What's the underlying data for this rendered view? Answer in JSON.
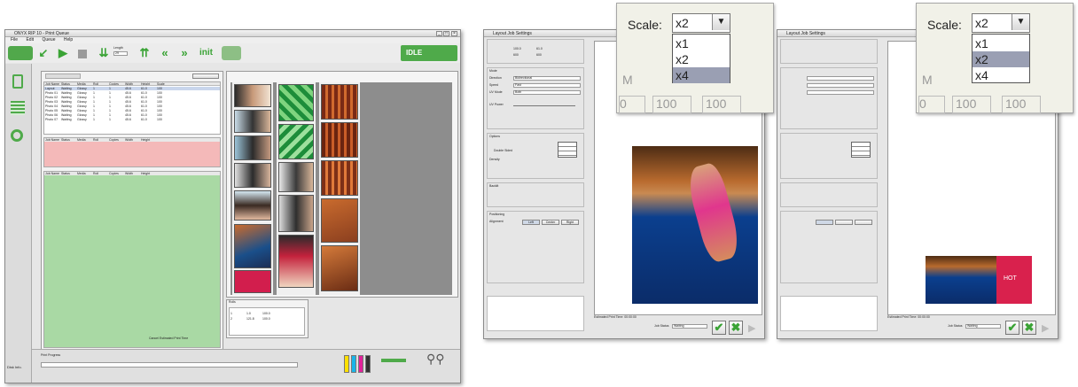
{
  "main": {
    "title": "ONYX RIP 10 - Print Queue",
    "menu": [
      "File",
      "Edit",
      "Queue",
      "Help"
    ],
    "toolbar": {
      "length_label": "Length",
      "length_value": "29",
      "init_label": "init"
    },
    "status": "IDLE",
    "queue_columns": [
      "Job Name",
      "Status",
      "Media",
      "Roll",
      "Copies",
      "Width",
      "Height",
      "Scale"
    ],
    "queue_rows": [
      [
        "Layout",
        "Waiting",
        "Glossy",
        "1",
        "1",
        "45.6",
        "61.0",
        "100"
      ],
      [
        "Photo 01",
        "Waiting",
        "Glossy",
        "1",
        "1",
        "45.6",
        "61.0",
        "100"
      ],
      [
        "Photo 02",
        "Waiting",
        "Glossy",
        "1",
        "1",
        "45.6",
        "61.0",
        "100"
      ],
      [
        "Photo 03",
        "Waiting",
        "Glossy",
        "1",
        "1",
        "45.6",
        "61.0",
        "100"
      ],
      [
        "Photo 04",
        "Waiting",
        "Glossy",
        "1",
        "1",
        "45.6",
        "61.0",
        "100"
      ],
      [
        "Photo 05",
        "Waiting",
        "Glossy",
        "1",
        "1",
        "45.6",
        "61.0",
        "100"
      ],
      [
        "Photo 06",
        "Waiting",
        "Glossy",
        "1",
        "1",
        "45.6",
        "61.0",
        "100"
      ],
      [
        "Photo 07",
        "Waiting",
        "Glossy",
        "1",
        "1",
        "45.6",
        "61.0",
        "100"
      ]
    ],
    "held_columns": [
      "Job Name",
      "Status",
      "Media",
      "Roll",
      "Copies",
      "Width",
      "Height"
    ],
    "printed_columns": [
      "Job Name",
      "Status",
      "Media",
      "Roll",
      "Copies",
      "Width",
      "Height"
    ],
    "rolls_label": "Rolls",
    "roll_rows": [
      [
        "1",
        "1.0",
        "100.0"
      ],
      [
        "2",
        "121.8",
        "100.0"
      ]
    ],
    "cancel_label": "Cancel Estimated Print Time",
    "print_progress_label": "Print Progress",
    "disk_label": "Disk Info."
  },
  "settings_left": {
    "title": "Layout Job Settings",
    "size_values": [
      "100.0",
      "61.0"
    ],
    "resolution_values": [
      "600",
      "600"
    ],
    "mode_label": "Mode",
    "direction_label": "Direction",
    "direction_value": "Bidirectional",
    "speed_label": "Speed",
    "speed_value": "Fast",
    "uv_mode_label": "UV Mode",
    "uv_mode_value": "Both",
    "uv_power_label": "UV Power",
    "options_label": "Options",
    "double_sided": "Double Sided",
    "density_label": "Density",
    "backlit_label": "Backlit",
    "positioning_label": "Positioning",
    "alignment_label": "Alignment",
    "align_buttons": [
      "Left",
      "Center",
      "Right"
    ],
    "estimated_time": "Estimated Print Time: 00:00:00",
    "job_status_label": "Job Status",
    "job_status_value": "Waiting",
    "ok_icon": "check-icon",
    "cancel_icon": "cross-icon"
  },
  "settings_right": {
    "title": "Layout Job Settings",
    "estimated_time": "Estimated Print Time: 00:00:00",
    "job_status_label": "Job Status",
    "job_status_value": "Waiting"
  },
  "zoom_left": {
    "scale_label": "Scale:",
    "selected": "x2",
    "options": [
      "x1",
      "x2",
      "x4"
    ],
    "highlighted": "x4",
    "background_letter": "M",
    "background_values": [
      "100",
      "100"
    ]
  },
  "zoom_right": {
    "scale_label": "Scale:",
    "selected": "x2",
    "options": [
      "x1",
      "x2",
      "x4"
    ],
    "highlighted": "x2",
    "background_letter": "M",
    "background_values": [
      "100",
      "100"
    ]
  },
  "preview_banner_text": "HOT"
}
